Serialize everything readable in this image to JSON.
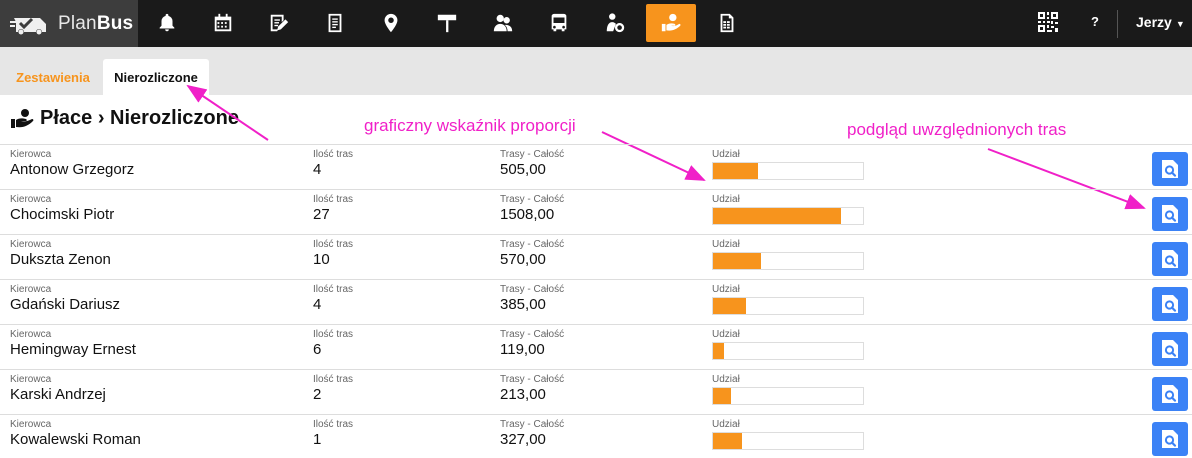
{
  "app": {
    "name_light": "Plan",
    "name_bold": "Bus"
  },
  "nav_icons": [
    {
      "name": "bell-icon",
      "active": false
    },
    {
      "name": "calendar-icon",
      "active": false
    },
    {
      "name": "edit-list-icon",
      "active": false
    },
    {
      "name": "document-icon",
      "active": false
    },
    {
      "name": "location-pin-icon",
      "active": false
    },
    {
      "name": "signpost-icon",
      "active": false
    },
    {
      "name": "users-icon",
      "active": false
    },
    {
      "name": "bus-icon",
      "active": false
    },
    {
      "name": "driver-wheel-icon",
      "active": false
    },
    {
      "name": "hand-money-icon",
      "active": true
    },
    {
      "name": "spreadsheet-icon",
      "active": false
    }
  ],
  "header": {
    "qr_icon": "qr-code-icon",
    "help": "?",
    "user": "Jerzy"
  },
  "tabs": [
    {
      "label": "Zestawienia",
      "active": false
    },
    {
      "label": "Nierozliczone",
      "active": true
    }
  ],
  "page": {
    "title": "Płace › Nierozliczone"
  },
  "annotations": {
    "bar": "graficzny wskaźnik proporcji",
    "view": "podgląd uwzględnionych tras"
  },
  "columns": {
    "driver": "Kierowca",
    "count": "Ilość tras",
    "total": "Trasy - Całość",
    "share": "Udział"
  },
  "rows": [
    {
      "driver": "Antonow Grzegorz",
      "count": "4",
      "total": "505,00",
      "share": 0.3
    },
    {
      "driver": "Chocimski Piotr",
      "count": "27",
      "total": "1508,00",
      "share": 0.85
    },
    {
      "driver": "Dukszta Zenon",
      "count": "10",
      "total": "570,00",
      "share": 0.32
    },
    {
      "driver": "Gdański Dariusz",
      "count": "4",
      "total": "385,00",
      "share": 0.22
    },
    {
      "driver": "Hemingway Ernest",
      "count": "6",
      "total": "119,00",
      "share": 0.07
    },
    {
      "driver": "Karski Andrzej",
      "count": "2",
      "total": "213,00",
      "share": 0.12
    },
    {
      "driver": "Kowalewski Roman",
      "count": "1",
      "total": "327,00",
      "share": 0.19
    }
  ],
  "colors": {
    "accent": "#f7941d",
    "button": "#3b82f6",
    "annotation": "#f020c8"
  }
}
